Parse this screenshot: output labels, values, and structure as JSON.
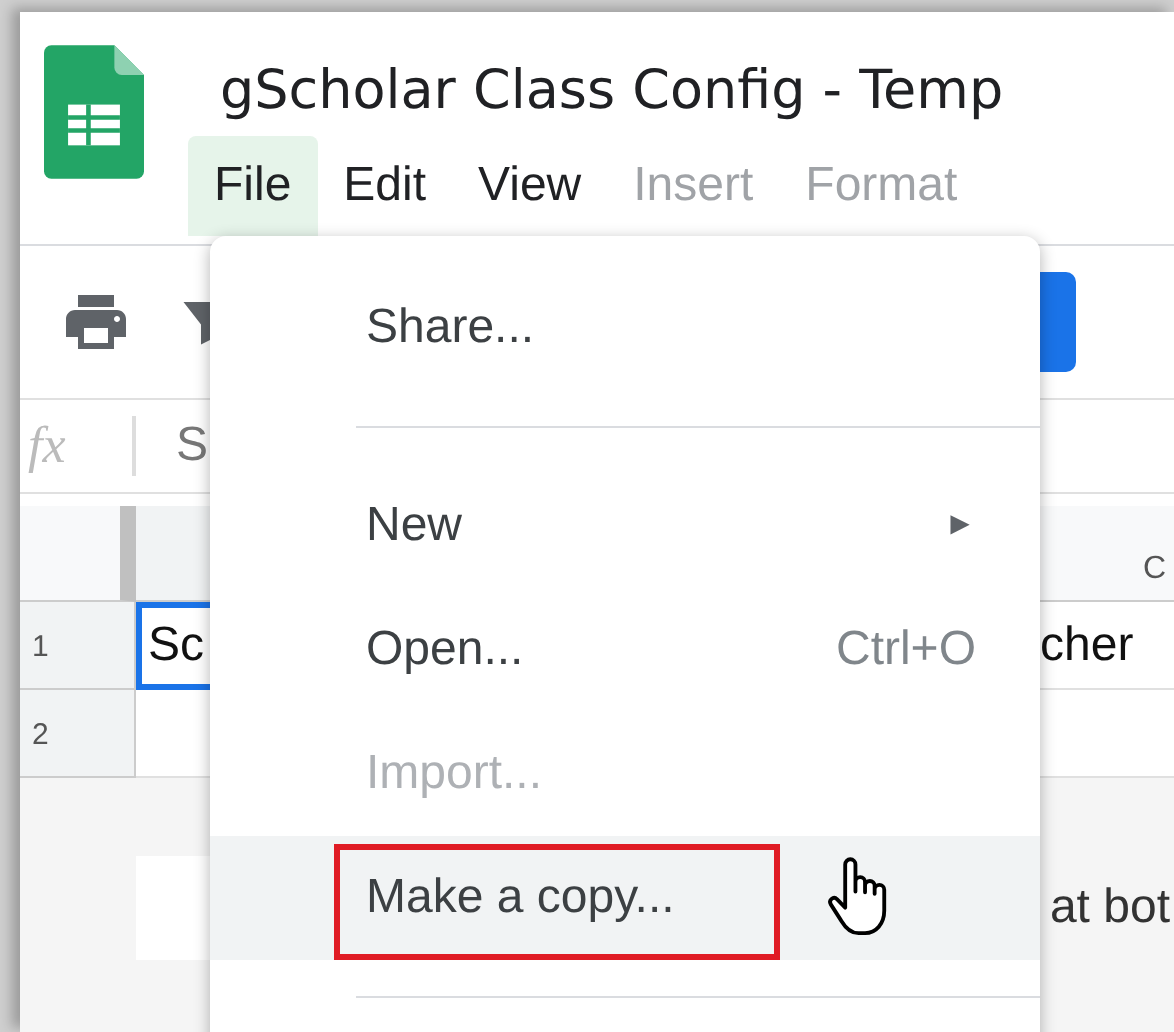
{
  "app": {
    "title": "gScholar Class Config - Temp"
  },
  "menu_bar": [
    {
      "label": "File",
      "selected": true,
      "disabled": false
    },
    {
      "label": "Edit",
      "selected": false,
      "disabled": false
    },
    {
      "label": "View",
      "selected": false,
      "disabled": false
    },
    {
      "label": "Insert",
      "selected": false,
      "disabled": true
    },
    {
      "label": "Format",
      "selected": false,
      "disabled": true
    }
  ],
  "formula_bar": {
    "label": "fx",
    "value": "S"
  },
  "grid": {
    "column_header": "C",
    "rows": [
      {
        "header": "1",
        "cell_a": "Sc",
        "cell_c": "cher",
        "selected": true
      },
      {
        "header": "2",
        "cell_a": "",
        "cell_c": "",
        "selected": false
      }
    ],
    "below_text": "at bot"
  },
  "file_menu": {
    "items": [
      {
        "kind": "item",
        "label": "Share...",
        "disabled": false,
        "hovered": false,
        "highlighted": false
      },
      {
        "kind": "divider"
      },
      {
        "kind": "submenu",
        "label": "New",
        "arrow": "►",
        "disabled": false,
        "hovered": false,
        "highlighted": false
      },
      {
        "kind": "item",
        "label": "Open...",
        "shortcut": "Ctrl+O",
        "disabled": false,
        "hovered": false,
        "highlighted": false
      },
      {
        "kind": "item",
        "label": "Import...",
        "disabled": true,
        "hovered": false,
        "highlighted": false
      },
      {
        "kind": "item",
        "label": "Make a copy...",
        "disabled": false,
        "hovered": true,
        "highlighted": true
      },
      {
        "kind": "divider"
      }
    ]
  }
}
